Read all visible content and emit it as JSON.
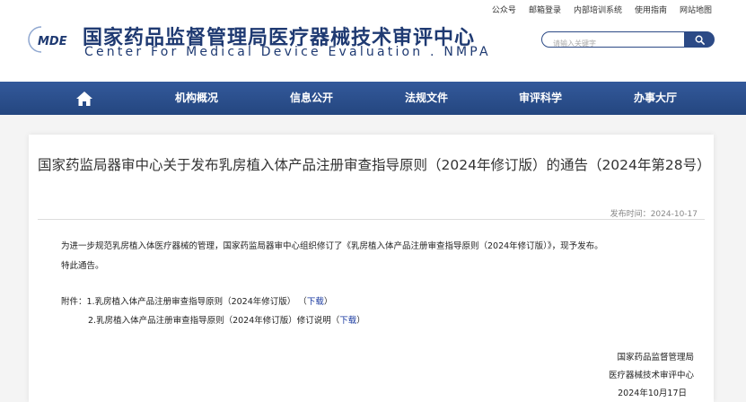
{
  "toplinks": [
    "公众号",
    "邮箱登录",
    "内部培训系统",
    "使用指南",
    "网站地图"
  ],
  "header": {
    "logo_text": "MDE",
    "title_cn": "国家药品监督管理局医疗器械技术审评中心",
    "title_en": "Center For Medical Device Evaluation . NMPA"
  },
  "search": {
    "placeholder": "请输入关键字"
  },
  "nav": {
    "items": [
      "机构概况",
      "信息公开",
      "法规文件",
      "审评科学",
      "办事大厅"
    ]
  },
  "article": {
    "title": "国家药监局器审中心关于发布乳房植入体产品注册审查指导原则（2024年修订版）的通告（2024年第28号）",
    "pubdate_label": "发布时间：",
    "pubdate": "2024-10-17",
    "paragraph1": "为进一步规范乳房植入体医疗器械的管理，国家药监局器审中心组织修订了《乳房植入体产品注册审查指导原则（2024年修订版）》，现予发布。",
    "paragraph2": "特此通告。",
    "attachments_label": "附件：",
    "attachment1": "1.乳房植入体产品注册审查指导原则（2024年修订版）",
    "attachment2": "2.乳房植入体产品注册审查指导原则（2024年修订版）修订说明",
    "download_label": "下载",
    "signature_org1": "国家药品监督管理局",
    "signature_org2": "医疗器械技术审评中心",
    "signature_date": "2024年10月17日"
  },
  "colors": {
    "brand": "#1f3a72",
    "nav": "#2c4a86",
    "link": "#1a3aa0"
  }
}
